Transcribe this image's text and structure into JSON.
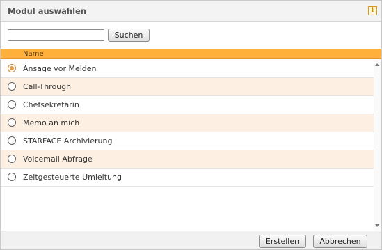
{
  "dialog": {
    "title": "Modul auswählen",
    "info_icon": "info-icon"
  },
  "search": {
    "value": "",
    "placeholder": "",
    "button_label": "Suchen"
  },
  "table": {
    "column_name": "Name",
    "selected_index": 0,
    "rows": [
      {
        "label": "Ansage vor Melden",
        "selected": true
      },
      {
        "label": "Call-Through",
        "selected": false
      },
      {
        "label": "Chefsekretärin",
        "selected": false
      },
      {
        "label": "Memo an mich",
        "selected": false
      },
      {
        "label": "STARFACE Archivierung",
        "selected": false
      },
      {
        "label": "Voicemail Abfrage",
        "selected": false
      },
      {
        "label": "Zeitgesteuerte Umleitung",
        "selected": false
      }
    ]
  },
  "footer": {
    "create_label": "Erstellen",
    "cancel_label": "Abbrechen"
  },
  "colors": {
    "header_accent": "#ffb03b",
    "row_alt": "#fdf0e3"
  }
}
